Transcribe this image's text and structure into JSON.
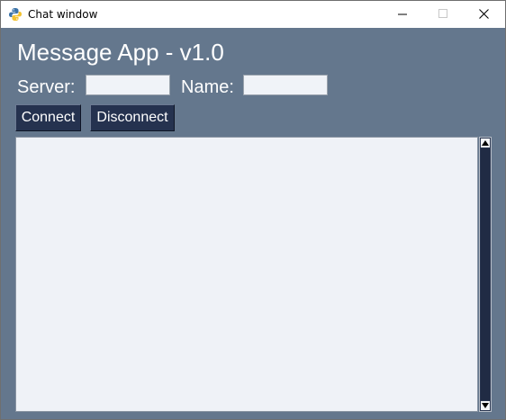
{
  "window": {
    "title": "Chat window",
    "app_icon": "python-icon",
    "controls": {
      "minimize_icon": "minimize-icon",
      "maximize_icon": "maximize-icon",
      "close_icon": "close-icon"
    }
  },
  "main": {
    "heading": "Message App - v1.0",
    "server_label": "Server:",
    "server_value": "",
    "name_label": "Name:",
    "name_value": "",
    "connect_label": "Connect",
    "disconnect_label": "Disconnect",
    "messages": []
  },
  "colors": {
    "background": "#64778d",
    "button": "#25324f",
    "message_area": "#eff2f7",
    "scrollbar": "#2a3650"
  }
}
